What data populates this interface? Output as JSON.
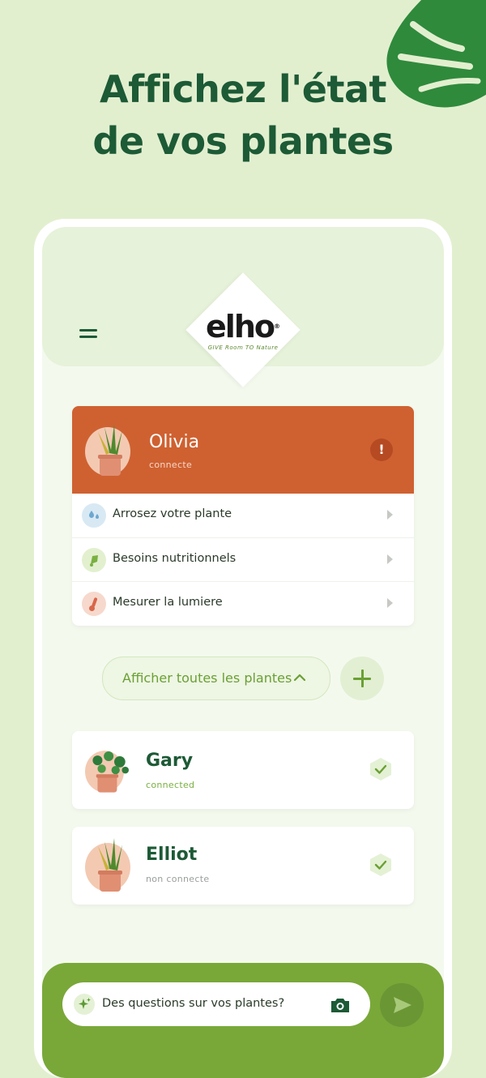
{
  "headline": {
    "line1": "Affichez l'état",
    "line2": "de vos plantes"
  },
  "header": {
    "logo_text": "elho",
    "logo_registered": "®",
    "logo_tagline": "GIVE Room TO Nature"
  },
  "featured_plant": {
    "name": "Olivia",
    "status": "connecte",
    "alert_symbol": "!",
    "actions": [
      {
        "label": "Arrosez votre plante",
        "icon": "water-drops-icon"
      },
      {
        "label": "Besoins nutritionnels",
        "icon": "nutrient-icon"
      },
      {
        "label": "Mesurer la lumiere",
        "icon": "thermometer-icon"
      }
    ]
  },
  "show_all_label": "Afficher toutes les plantes",
  "plants": [
    {
      "name": "Gary",
      "status": "connected",
      "status_color": "#7ab042"
    },
    {
      "name": "Elliot",
      "status": "non connecte",
      "status_color": "#9aa09a"
    }
  ],
  "ask": {
    "placeholder": "Des questions sur vos plantes?"
  },
  "colors": {
    "primary_green": "#1d5a36",
    "accent_orange": "#cf6131",
    "light_green": "#79a839"
  }
}
